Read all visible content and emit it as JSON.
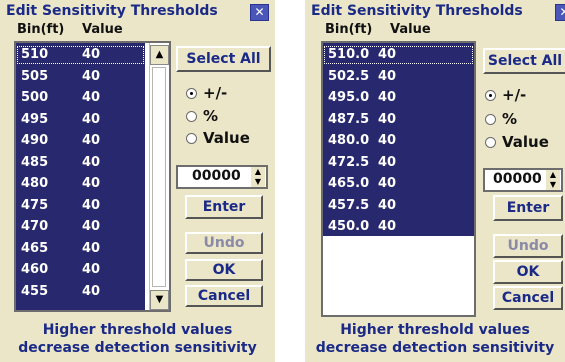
{
  "colors": {
    "window_background": "#ece6c9",
    "list_selection": "#27286e",
    "title_text": "#1a2a86",
    "close_button": "#4a57b8"
  },
  "dialogs": [
    {
      "title": "Edit Sensitivity Thresholds",
      "close_icon": "close-icon",
      "columns": {
        "bin": "Bin(ft)",
        "value": "Value"
      },
      "rows": [
        {
          "bin": "510",
          "value": "40"
        },
        {
          "bin": "505",
          "value": "40"
        },
        {
          "bin": "500",
          "value": "40"
        },
        {
          "bin": "495",
          "value": "40"
        },
        {
          "bin": "490",
          "value": "40"
        },
        {
          "bin": "485",
          "value": "40"
        },
        {
          "bin": "480",
          "value": "40"
        },
        {
          "bin": "475",
          "value": "40"
        },
        {
          "bin": "470",
          "value": "40"
        },
        {
          "bin": "465",
          "value": "40"
        },
        {
          "bin": "460",
          "value": "40"
        },
        {
          "bin": "455",
          "value": "40"
        }
      ],
      "has_scrollbar": true,
      "buttons": {
        "select_all": "Select All",
        "enter": "Enter",
        "undo": "Undo",
        "ok": "OK",
        "cancel": "Cancel"
      },
      "modes": [
        {
          "label": "+/-",
          "checked": true
        },
        {
          "label": "%",
          "checked": false
        },
        {
          "label": "Value",
          "checked": false
        }
      ],
      "spin_value": "00000",
      "footer": [
        "Higher threshold values",
        "decrease detection sensitivity"
      ]
    },
    {
      "title": "Edit Sensitivity Thresholds",
      "close_icon": "close-icon",
      "columns": {
        "bin": "Bin(ft)",
        "value": "Value"
      },
      "rows": [
        {
          "bin": "510.0",
          "value": "40"
        },
        {
          "bin": "502.5",
          "value": "40"
        },
        {
          "bin": "495.0",
          "value": "40"
        },
        {
          "bin": "487.5",
          "value": "40"
        },
        {
          "bin": "480.0",
          "value": "40"
        },
        {
          "bin": "472.5",
          "value": "40"
        },
        {
          "bin": "465.0",
          "value": "40"
        },
        {
          "bin": "457.5",
          "value": "40"
        },
        {
          "bin": "450.0",
          "value": "40"
        }
      ],
      "has_scrollbar": false,
      "buttons": {
        "select_all": "Select All",
        "enter": "Enter",
        "undo": "Undo",
        "ok": "OK",
        "cancel": "Cancel"
      },
      "modes": [
        {
          "label": "+/-",
          "checked": true
        },
        {
          "label": "%",
          "checked": false
        },
        {
          "label": "Value",
          "checked": false
        }
      ],
      "spin_value": "00000",
      "footer": [
        "Higher threshold values",
        "decrease detection sensitivity"
      ]
    }
  ]
}
